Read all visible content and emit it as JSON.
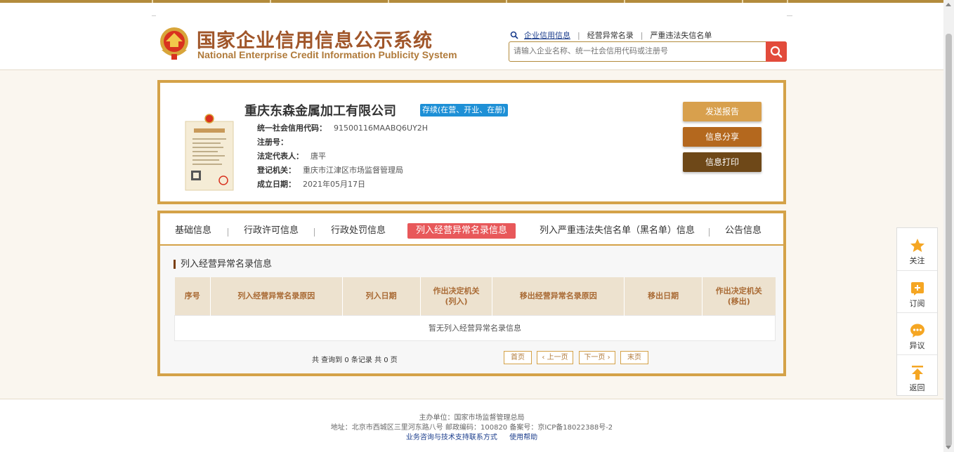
{
  "header": {
    "title_cn": "国家企业信用信息公示系统",
    "title_en": "National Enterprise Credit Information Publicity System",
    "quicklinks": [
      "企业信用信息",
      "经营异常名录",
      "严重违法失信名单"
    ],
    "search_placeholder": "请输入企业名称、统一社会信用代码或注册号"
  },
  "company": {
    "name": "重庆东森金属加工有限公司",
    "status": "存续(在营、开业、在册)",
    "fields": [
      {
        "label": "统一社会信用代码：",
        "value": "91500116MAABQ6UY2H"
      },
      {
        "label": "注册号：",
        "value": ""
      },
      {
        "label": "法定代表人：",
        "value": "唐平"
      },
      {
        "label": "登记机关：",
        "value": "重庆市江津区市场监督管理局"
      },
      {
        "label": "成立日期：",
        "value": "2021年05月17日"
      }
    ],
    "actions": [
      "发送报告",
      "信息分享",
      "信息打印"
    ]
  },
  "tabs": [
    "基础信息",
    "行政许可信息",
    "行政处罚信息",
    "列入经营异常名录信息",
    "列入严重违法失信名单（黑名单）信息",
    "公告信息"
  ],
  "active_tab": 3,
  "section": {
    "title": "列入经营异常名录信息",
    "columns": [
      "序号",
      "列入经营异常名录原因",
      "列入日期",
      "作出决定机关\n(列入)",
      "移出经营异常名录原因",
      "移出日期",
      "作出决定机关\n(移出)"
    ],
    "empty_text": "暂无列入经营异常名录信息",
    "pager_total": "共 查询到 0 条记录 共 0 页",
    "pager_buttons": [
      "首页",
      "‹ 上一页",
      "下一页 ›",
      "末页"
    ]
  },
  "sidebar_tools": [
    {
      "label": "关注",
      "icon": "star-icon"
    },
    {
      "label": "订阅",
      "icon": "subscribe-icon"
    },
    {
      "label": "异议",
      "icon": "chat-icon"
    },
    {
      "label": "返回",
      "icon": "back-top-icon"
    }
  ],
  "footer": {
    "sponsor": "主办单位：国家市场监督管理总局",
    "address": "地址：北京市西城区三里河东路八号   邮政编码：100820   备案号：京ICP备18022388号-2",
    "links": [
      "业务咨询与技术支持联系方式",
      "使用帮助"
    ]
  },
  "colors": {
    "gold_border": "#d4a248",
    "active_tab": "#e8585a",
    "status_badge": "#1e90d6",
    "title_brown": "#a0562a"
  }
}
